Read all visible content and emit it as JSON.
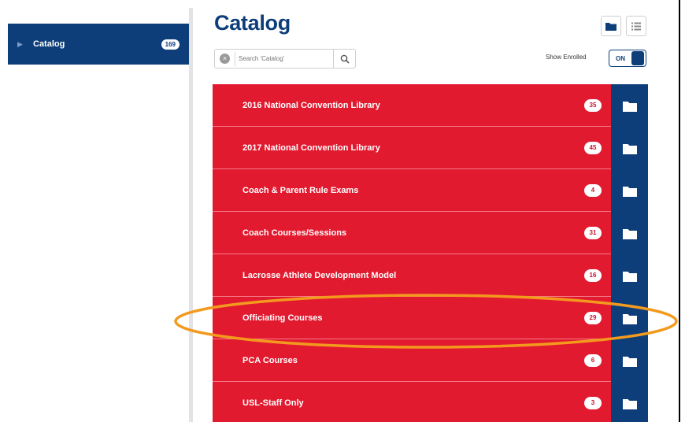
{
  "sidebar": {
    "item": {
      "label": "Catalog",
      "count": "169"
    }
  },
  "header": {
    "title": "Catalog",
    "search": {
      "placeholder": "Search 'Catalog'"
    },
    "show_enrolled_label": "Show Enrolled",
    "toggle_label": "ON"
  },
  "catalog": {
    "items": [
      {
        "label": "2016 National Convention Library",
        "count": "35"
      },
      {
        "label": "2017 National Convention Library",
        "count": "45"
      },
      {
        "label": "Coach & Parent Rule Exams",
        "count": "4"
      },
      {
        "label": "Coach Courses/Sessions",
        "count": "31"
      },
      {
        "label": "Lacrosse Athlete Development Model",
        "count": "16"
      },
      {
        "label": "Officiating Courses",
        "count": "29"
      },
      {
        "label": "PCA Courses",
        "count": "6"
      },
      {
        "label": "USL-Staff Only",
        "count": "3"
      }
    ]
  },
  "colors": {
    "navy": "#0d3e7a",
    "row_red": "#e21a2f",
    "highlight_orange": "#f39a1e"
  },
  "icons": [
    "chevron-right-icon",
    "folder-icon",
    "list-icon",
    "clear-icon",
    "search-icon"
  ]
}
